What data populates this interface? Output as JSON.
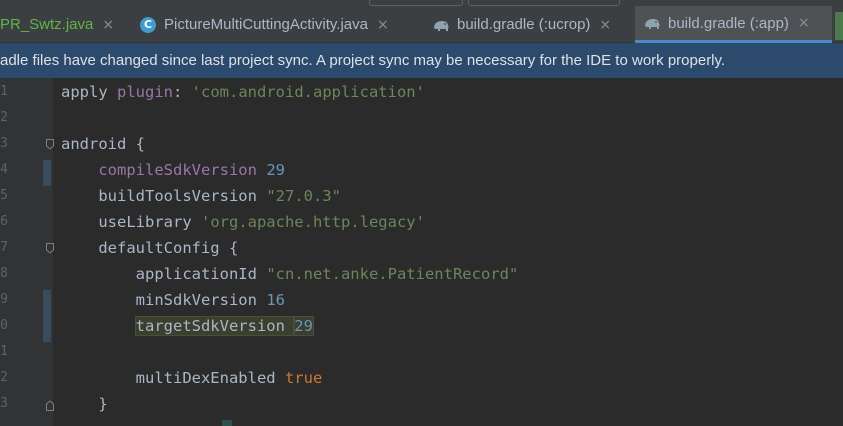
{
  "tabs": [
    {
      "label": "PR_Swtz.java",
      "icon": "java-file-icon",
      "active": false
    },
    {
      "label": "PictureMultiCuttingActivity.java",
      "icon": "java-class-icon",
      "active": false
    },
    {
      "label": "build.gradle (:ucrop)",
      "icon": "gradle-elephant-icon",
      "active": false
    },
    {
      "label": "build.gradle (:app)",
      "icon": "gradle-elephant-icon",
      "active": true
    }
  ],
  "close_glyph": "×",
  "notice": {
    "text": "radle files have changed since last project sync. A project sync may be necessary for the IDE to work properly."
  },
  "editor": {
    "lines": [
      {
        "num": "1",
        "code": [
          [
            "apply ",
            ""
          ],
          [
            "plugin",
            "kw-purple"
          ],
          [
            ": ",
            ""
          ],
          [
            "'com.android.application'",
            "str-green"
          ]
        ]
      },
      {
        "num": "2",
        "code": []
      },
      {
        "num": "3",
        "code": [
          [
            "android {",
            ""
          ]
        ]
      },
      {
        "num": "4",
        "code": [
          [
            "    ",
            ""
          ],
          [
            "compileSdkVersion",
            "kw-purple"
          ],
          [
            " ",
            ""
          ],
          [
            "29",
            "num-blue"
          ]
        ]
      },
      {
        "num": "5",
        "code": [
          [
            "    buildToolsVersion ",
            ""
          ],
          [
            "\"27.0.3\"",
            "str-green"
          ]
        ]
      },
      {
        "num": "6",
        "code": [
          [
            "    useLibrary ",
            ""
          ],
          [
            "'org.apache.http.legacy'",
            "str-green"
          ]
        ]
      },
      {
        "num": "7",
        "code": [
          [
            "    defaultConfig {",
            ""
          ]
        ]
      },
      {
        "num": "8",
        "code": [
          [
            "        applicationId ",
            ""
          ],
          [
            "\"cn.net.anke.PatientRecord\"",
            "str-green"
          ]
        ]
      },
      {
        "num": "9",
        "code": [
          [
            "        minSdkVersion ",
            ""
          ],
          [
            "16",
            "num-blue"
          ]
        ]
      },
      {
        "num": "0",
        "code": [
          [
            "        ",
            ""
          ],
          [
            "targetSdkVersion ",
            "hl"
          ],
          [
            "29",
            "num-blue hl"
          ]
        ]
      },
      {
        "num": "1",
        "code": []
      },
      {
        "num": "2",
        "code": [
          [
            "        multiDexEnabled ",
            ""
          ],
          [
            "true",
            "kw-orange"
          ]
        ]
      },
      {
        "num": "3",
        "code": [
          [
            "    }",
            ""
          ]
        ]
      }
    ]
  },
  "colors": {
    "editor_bg": "#2b2b2b",
    "tabbar_bg": "#3c3f41",
    "notice_bg": "#2c4a6b",
    "active_tab_underline": "#4a88c7",
    "string": "#6a8759",
    "number": "#6897bb",
    "keyword_purple": "#9876aa",
    "keyword_orange": "#cc7832"
  }
}
